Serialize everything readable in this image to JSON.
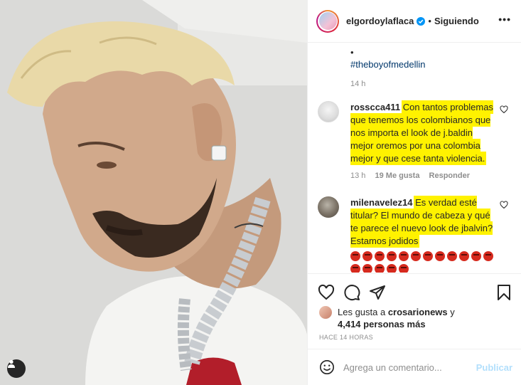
{
  "post": {
    "username": "elgordoylaflaca",
    "separator": "•",
    "follow_status": "Siguiendo",
    "more_label": "•••"
  },
  "caption": {
    "bullet": "•",
    "hashtag": "#theboyofmedellin",
    "time": "14 h"
  },
  "comments": [
    {
      "username": "rosscca411",
      "text": "Con tantos problemas que tenemos los colombianos que nos importa el look de j.baldin mejor oremos por una colombia mejor y que cese tanta violencia.",
      "time": "13 h",
      "likes": "19 Me gusta",
      "reply": "Responder"
    },
    {
      "username": "milenavelez14",
      "text": "Es verdad esté titular? El mundo de cabeza y qué te parece el nuevo look de jbalvin? Estamos jodidos",
      "emoji_count": 17
    }
  ],
  "likes": {
    "prefix": "Les gusta a ",
    "user": "crosarionews",
    "connector": " y",
    "count": "4,414 personas más"
  },
  "timestamp": "HACE 14 HORAS",
  "comment_box": {
    "placeholder": "Agrega un comentario...",
    "publish_label": "Publicar"
  },
  "icons": {
    "verified": "verified-badge-icon",
    "heart": "heart-icon",
    "comment": "comment-icon",
    "share": "paper-plane-icon",
    "save": "bookmark-icon",
    "emoji": "smiley-icon",
    "user_tag": "user-icon",
    "emoji_reaction": "angry-face-emoji"
  },
  "colors": {
    "highlight": "#fff200",
    "link": "#00376b",
    "verified": "#0095f6",
    "publish_disabled": "#b2dffc"
  }
}
